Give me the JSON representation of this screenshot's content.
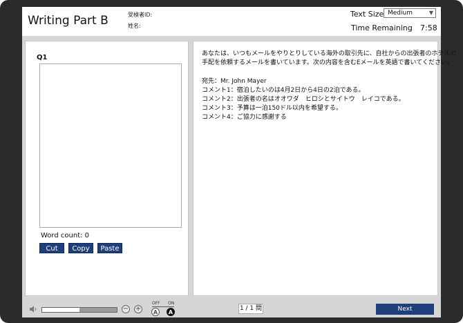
{
  "header": {
    "title": "Writing Part B",
    "candidate_id_label": "受検者ID:",
    "name_label": "姓名:",
    "text_size_label": "Text Size",
    "text_size_value": "Medium",
    "time_remaining_label": "Time Remaining",
    "time_remaining_value": "7:58"
  },
  "left": {
    "question_label": "Q1",
    "answer_text": "",
    "word_count": "Word count: 0",
    "cut_label": "Cut",
    "copy_label": "Copy",
    "paste_label": "Paste"
  },
  "prompt": {
    "intro_line1": "あなたは、いつもメールをやりとりしている海外の取引先に、自社からの出張者のホテルの",
    "intro_line2": "手配を依頼するメールを書いています。次の内容を含むEメールを英語で書いてください。",
    "recipient": "宛先：Mr. John Mayer",
    "comment1": "コメント1：宿泊したいのは4月2日から4日の2泊である。",
    "comment2": "コメント2：出張者の名はオオワダ　ヒロシとサイトウ　レイコである。",
    "comment3": "コメント3：予算は一泊150ドル以内を希望する。",
    "comment4": "コメント4：ご協力に感謝する"
  },
  "footer": {
    "volume_level": 0.5,
    "off_label": "OFF",
    "on_label": "ON",
    "toggle_off_glyph": "A",
    "toggle_on_glyph": "A",
    "minus_glyph": "−",
    "plus_glyph": "+",
    "page_indicator": "1 / 1 問",
    "next_label": "Next"
  },
  "colors": {
    "accent": "#1f3f7a",
    "frame": "#2b2b2b",
    "background": "#d6d6d6"
  }
}
